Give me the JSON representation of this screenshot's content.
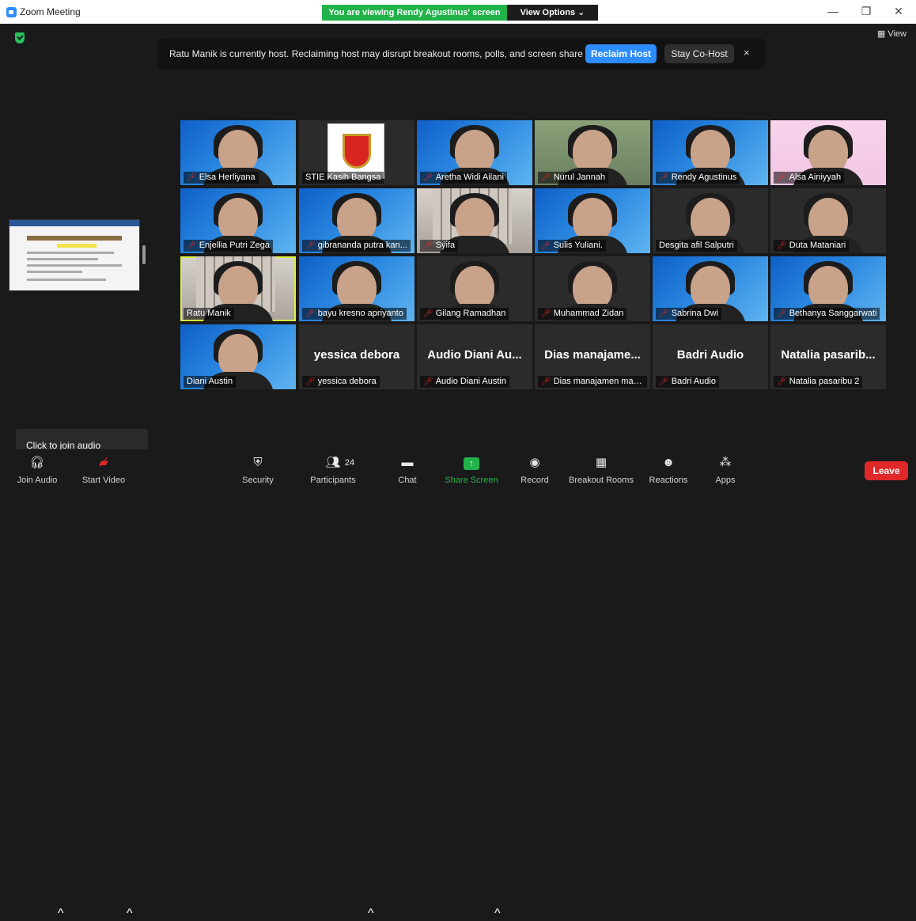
{
  "window": {
    "title": "Zoom Meeting",
    "viewing_banner": "You are viewing Rendy Agustinus' screen",
    "view_options": "View Options",
    "view_label": "View"
  },
  "host_notice": {
    "message": "Ratu Manik is currently host. Reclaiming host may disrupt breakout rooms, polls, and screen share",
    "reclaim_label": "Reclaim Host",
    "stay_label": "Stay Co-Host",
    "close_icon": "×"
  },
  "tooltip": "Click to join audio",
  "participants": [
    {
      "name": "Elsa Herliyana",
      "muted": true,
      "bg": "blue"
    },
    {
      "name": "STIE Kasih Bangsa",
      "muted": false,
      "bg": "logo"
    },
    {
      "name": "Aretha Widi Ailani",
      "muted": true,
      "bg": "blue"
    },
    {
      "name": "Nurul Jannah",
      "muted": true,
      "bg": "green"
    },
    {
      "name": "Rendy Agustinus",
      "muted": true,
      "bg": "blue"
    },
    {
      "name": "Alsa Ainiyyah",
      "muted": true,
      "bg": "pink"
    },
    {
      "name": "Enjellia Putri Zega",
      "muted": true,
      "bg": "blue"
    },
    {
      "name": "gibrananda putra kan...",
      "muted": true,
      "bg": "blue"
    },
    {
      "name": "Syifa",
      "muted": true,
      "bg": "room"
    },
    {
      "name": "Sulis Yuliani.",
      "muted": true,
      "bg": "blue"
    },
    {
      "name": "Desgita afil Salputri",
      "muted": false,
      "bg": "dark"
    },
    {
      "name": "Duta Mataniari",
      "muted": true,
      "bg": "dark"
    },
    {
      "name": "Ratu Manik",
      "muted": false,
      "bg": "room",
      "active": true
    },
    {
      "name": "bayu kresno apriyanto",
      "muted": true,
      "bg": "blue"
    },
    {
      "name": "Gilang Ramadhan",
      "muted": true,
      "bg": "dark"
    },
    {
      "name": "Muhammad Zidan",
      "muted": true,
      "bg": "dark"
    },
    {
      "name": "Sabrina Dwi",
      "muted": true,
      "bg": "blue"
    },
    {
      "name": "Bethanya Sanggarwati",
      "muted": true,
      "bg": "blue"
    },
    {
      "name": "Diani Austin",
      "muted": false,
      "bg": "blue"
    },
    {
      "name": "yessica debora",
      "muted": true,
      "bg": "text",
      "display": "yessica debora"
    },
    {
      "name": "Audio Diani Austin",
      "muted": true,
      "bg": "text",
      "display": "Audio Diani Au..."
    },
    {
      "name": "Dias manajamen malam",
      "muted": true,
      "bg": "text",
      "display": "Dias manajame..."
    },
    {
      "name": "Badri Audio",
      "muted": true,
      "bg": "text",
      "display": "Badri Audio"
    },
    {
      "name": "Natalia pasaribu 2",
      "muted": true,
      "bg": "text",
      "display": "Natalia pasarib..."
    }
  ],
  "toolbar": {
    "join_audio": "Join Audio",
    "start_video": "Start Video",
    "security": "Security",
    "participants": "Participants",
    "participants_count": "24",
    "chat": "Chat",
    "share_screen": "Share Screen",
    "record": "Record",
    "breakout_rooms": "Breakout Rooms",
    "reactions": "Reactions",
    "apps": "Apps",
    "leave": "Leave"
  },
  "colors": {
    "accent_blue": "#2d8cff",
    "share_green": "#21b34a",
    "leave_red": "#e02828",
    "active_speaker": "#d9f241"
  }
}
